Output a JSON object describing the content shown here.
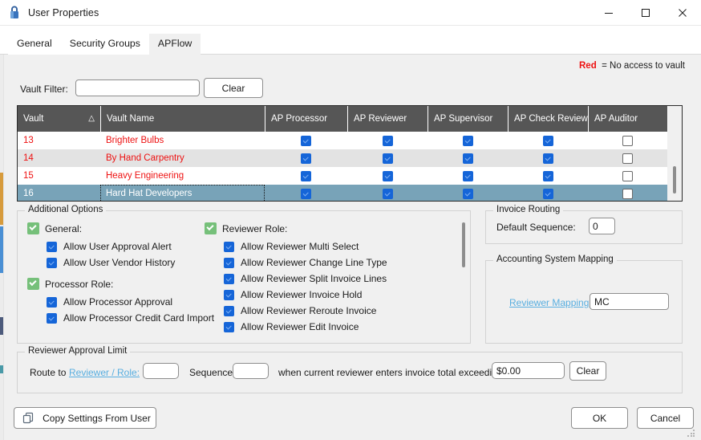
{
  "window": {
    "title": "User Properties",
    "icon": "lock-icon",
    "minimize": "minimize-icon",
    "maximize": "maximize-icon",
    "close": "close-icon"
  },
  "tabs": [
    {
      "label": "General",
      "active": false
    },
    {
      "label": "Security Groups",
      "active": false
    },
    {
      "label": "APFlow",
      "active": true
    }
  ],
  "legend": {
    "keyword": "Red",
    "text": "= No access to vault"
  },
  "vault_filter": {
    "label": "Vault Filter:",
    "value": "",
    "placeholder": "",
    "clear_label": "Clear"
  },
  "grid": {
    "columns": [
      "Vault",
      "Vault Name",
      "AP Processor",
      "AP Reviewer",
      "AP Supervisor",
      "AP Check Review",
      "AP Auditor"
    ],
    "sort_column": "Vault",
    "sort_indicator": "△",
    "rows": [
      {
        "vault": "13",
        "name": "Brighter Bulbs",
        "processor": true,
        "reviewer": true,
        "supervisor": true,
        "check_review": true,
        "auditor": false,
        "selected": false
      },
      {
        "vault": "14",
        "name": "By Hand Carpentry",
        "processor": true,
        "reviewer": true,
        "supervisor": true,
        "check_review": true,
        "auditor": false,
        "selected": false
      },
      {
        "vault": "15",
        "name": "Heavy Engineering",
        "processor": true,
        "reviewer": true,
        "supervisor": true,
        "check_review": true,
        "auditor": false,
        "selected": false
      },
      {
        "vault": "16",
        "name": "Hard Hat Developers",
        "processor": true,
        "reviewer": true,
        "supervisor": true,
        "check_review": true,
        "auditor": false,
        "selected": true
      }
    ]
  },
  "additional_options": {
    "title": "Additional Options",
    "left_groups": [
      {
        "header": "General:",
        "header_checked": true,
        "items": [
          {
            "label": "Allow User Approval Alert",
            "checked": true
          },
          {
            "label": "Allow User Vendor History",
            "checked": true
          }
        ]
      },
      {
        "header": "Processor Role:",
        "header_checked": true,
        "items": [
          {
            "label": "Allow Processor Approval",
            "checked": true
          },
          {
            "label": "Allow Processor Credit Card Import",
            "checked": true
          }
        ]
      }
    ],
    "right_groups": [
      {
        "header": "Reviewer Role:",
        "header_checked": true,
        "items": [
          {
            "label": "Allow Reviewer Multi Select",
            "checked": true
          },
          {
            "label": "Allow Reviewer Change Line Type",
            "checked": true
          },
          {
            "label": "Allow Reviewer Split Invoice Lines",
            "checked": true
          },
          {
            "label": "Allow Reviewer Invoice Hold",
            "checked": true
          },
          {
            "label": "Allow Reviewer Reroute Invoice",
            "checked": true
          },
          {
            "label": "Allow Reviewer Edit Invoice",
            "checked": true
          }
        ]
      }
    ]
  },
  "invoice_routing": {
    "title": "Invoice Routing",
    "sequence_label": "Default Sequence:",
    "sequence_value": "0"
  },
  "accounting_mapping": {
    "title": "Accounting System Mapping",
    "reviewer_mapping_label": "Reviewer Mapping:",
    "reviewer_mapping_value": "MC"
  },
  "reviewer_limit": {
    "title": "Reviewer Approval Limit",
    "route_to_label": "Route to",
    "role_link": "Reviewer / Role:",
    "role_value": "",
    "sequence_label": "Sequence:",
    "sequence_value": "",
    "condition_text": "when current reviewer enters invoice total exceeding:",
    "amount_value": "$0.00",
    "clear_label": "Clear"
  },
  "footer": {
    "copy_settings_label": "Copy Settings From User",
    "copy_icon": "copy-icon",
    "ok_label": "OK",
    "cancel_label": "Cancel"
  }
}
